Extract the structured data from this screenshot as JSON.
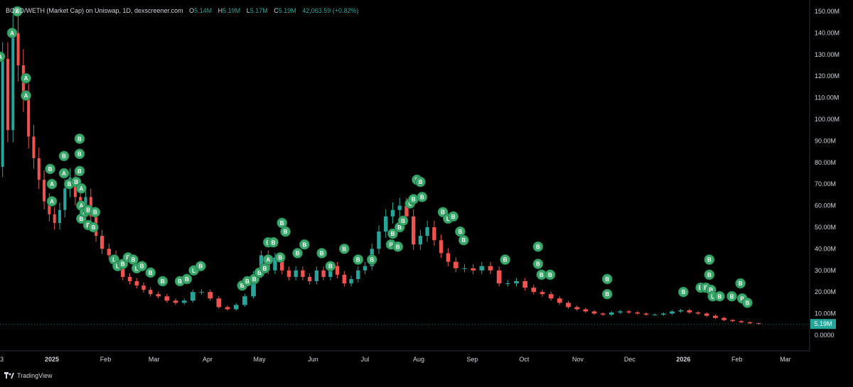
{
  "header": {
    "symbol": "BOBO/WETH (Market Cap) on Uniswap, 1D, dexscreener.com",
    "o_label": "O",
    "o_value": "5.14M",
    "h_label": "H",
    "h_value": "5.19M",
    "l_label": "L",
    "l_value": "5.17M",
    "c_label": "C",
    "c_value": "5.19M",
    "change": "42,063.59 (+0.82%)"
  },
  "footer": {
    "brand": "TradingView"
  },
  "colors": {
    "background": "#000000",
    "up": "#26a69a",
    "down": "#ef5350",
    "marker": "#3aa86b",
    "price_tag": "#26a69a",
    "axis_text": "#d1d4dc"
  },
  "chart_data": {
    "type": "candlestick",
    "title": "",
    "y_axis": {
      "ylim": [
        0,
        150000000
      ],
      "ticks": [
        {
          "value": 0,
          "label": "0.0000"
        },
        {
          "value": 10000000,
          "label": "10.00M"
        },
        {
          "value": 20000000,
          "label": "20.00M"
        },
        {
          "value": 30000000,
          "label": "30.00M"
        },
        {
          "value": 40000000,
          "label": "40.00M"
        },
        {
          "value": 50000000,
          "label": "50.00M"
        },
        {
          "value": 60000000,
          "label": "60.00M"
        },
        {
          "value": 70000000,
          "label": "70.00M"
        },
        {
          "value": 80000000,
          "label": "80.00M"
        },
        {
          "value": 90000000,
          "label": "90.00M"
        },
        {
          "value": 100000000,
          "label": "100.00M"
        },
        {
          "value": 110000000,
          "label": "110.00M"
        },
        {
          "value": 120000000,
          "label": "120.00M"
        },
        {
          "value": 130000000,
          "label": "130.00M"
        },
        {
          "value": 140000000,
          "label": "140.00M"
        },
        {
          "value": 150000000,
          "label": "150.00M"
        }
      ]
    },
    "x_axis": {
      "xlim": [
        "2024-12-02",
        "2026-03-15"
      ],
      "ticks": [
        {
          "date": "2024-12-03",
          "label": "3",
          "bold": false
        },
        {
          "date": "2025-01-01",
          "label": "2025",
          "bold": true
        },
        {
          "date": "2025-02-01",
          "label": "Feb",
          "bold": false
        },
        {
          "date": "2025-03-01",
          "label": "Mar",
          "bold": false
        },
        {
          "date": "2025-04-01",
          "label": "Apr",
          "bold": false
        },
        {
          "date": "2025-05-01",
          "label": "May",
          "bold": false
        },
        {
          "date": "2025-06-01",
          "label": "Jun",
          "bold": false
        },
        {
          "date": "2025-07-01",
          "label": "Jul",
          "bold": false
        },
        {
          "date": "2025-08-01",
          "label": "Aug",
          "bold": false
        },
        {
          "date": "2025-09-01",
          "label": "Sep",
          "bold": false
        },
        {
          "date": "2025-10-01",
          "label": "Oct",
          "bold": false
        },
        {
          "date": "2025-11-01",
          "label": "Nov",
          "bold": false
        },
        {
          "date": "2025-12-01",
          "label": "Dec",
          "bold": false
        },
        {
          "date": "2026-01-01",
          "label": "2026",
          "bold": true
        },
        {
          "date": "2026-02-01",
          "label": "Feb",
          "bold": false
        },
        {
          "date": "2026-03-01",
          "label": "Mar",
          "bold": false
        }
      ]
    },
    "last_price": {
      "value": 5190000,
      "label": "5.19M"
    },
    "series": [
      {
        "date": "2024-12-02",
        "close": 78000000
      },
      {
        "date": "2024-12-05",
        "close": 128000000
      },
      {
        "date": "2024-12-08",
        "close": 95000000
      },
      {
        "date": "2024-12-11",
        "close": 140000000
      },
      {
        "date": "2024-12-14",
        "close": 125000000
      },
      {
        "date": "2024-12-17",
        "close": 110000000
      },
      {
        "date": "2024-12-20",
        "close": 92000000
      },
      {
        "date": "2024-12-23",
        "close": 82000000
      },
      {
        "date": "2024-12-26",
        "close": 72000000
      },
      {
        "date": "2024-12-29",
        "close": 62000000
      },
      {
        "date": "2025-01-01",
        "close": 56000000
      },
      {
        "date": "2025-01-04",
        "close": 52000000
      },
      {
        "date": "2025-01-07",
        "close": 58000000
      },
      {
        "date": "2025-01-10",
        "close": 68000000
      },
      {
        "date": "2025-01-13",
        "close": 73000000
      },
      {
        "date": "2025-01-16",
        "close": 64000000
      },
      {
        "date": "2025-01-19",
        "close": 60000000
      },
      {
        "date": "2025-01-22",
        "close": 64000000
      },
      {
        "date": "2025-01-25",
        "close": 55000000
      },
      {
        "date": "2025-01-28",
        "close": 46000000
      },
      {
        "date": "2025-02-01",
        "close": 40000000
      },
      {
        "date": "2025-02-05",
        "close": 37000000
      },
      {
        "date": "2025-02-09",
        "close": 32000000
      },
      {
        "date": "2025-02-13",
        "close": 27000000
      },
      {
        "date": "2025-02-17",
        "close": 25000000
      },
      {
        "date": "2025-02-21",
        "close": 23000000
      },
      {
        "date": "2025-02-25",
        "close": 21000000
      },
      {
        "date": "2025-03-01",
        "close": 19000000
      },
      {
        "date": "2025-03-06",
        "close": 18000000
      },
      {
        "date": "2025-03-11",
        "close": 16000000
      },
      {
        "date": "2025-03-16",
        "close": 15000000
      },
      {
        "date": "2025-03-21",
        "close": 16000000
      },
      {
        "date": "2025-03-26",
        "close": 20000000
      },
      {
        "date": "2025-03-31",
        "close": 20000000
      },
      {
        "date": "2025-04-05",
        "close": 17000000
      },
      {
        "date": "2025-04-10",
        "close": 13000000
      },
      {
        "date": "2025-04-15",
        "close": 12000000
      },
      {
        "date": "2025-04-20",
        "close": 14000000
      },
      {
        "date": "2025-04-25",
        "close": 18000000
      },
      {
        "date": "2025-04-30",
        "close": 28000000
      },
      {
        "date": "2025-05-04",
        "close": 37000000
      },
      {
        "date": "2025-05-08",
        "close": 30000000
      },
      {
        "date": "2025-05-12",
        "close": 36000000
      },
      {
        "date": "2025-05-16",
        "close": 30000000
      },
      {
        "date": "2025-05-20",
        "close": 27000000
      },
      {
        "date": "2025-05-24",
        "close": 30000000
      },
      {
        "date": "2025-05-28",
        "close": 27000000
      },
      {
        "date": "2025-06-01",
        "close": 25000000
      },
      {
        "date": "2025-06-05",
        "close": 30000000
      },
      {
        "date": "2025-06-09",
        "close": 27000000
      },
      {
        "date": "2025-06-13",
        "close": 32000000
      },
      {
        "date": "2025-06-17",
        "close": 28000000
      },
      {
        "date": "2025-06-21",
        "close": 24000000
      },
      {
        "date": "2025-06-25",
        "close": 26000000
      },
      {
        "date": "2025-06-29",
        "close": 30000000
      },
      {
        "date": "2025-07-03",
        "close": 32000000
      },
      {
        "date": "2025-07-07",
        "close": 40000000
      },
      {
        "date": "2025-07-11",
        "close": 48000000
      },
      {
        "date": "2025-07-15",
        "close": 55000000
      },
      {
        "date": "2025-07-19",
        "close": 58000000
      },
      {
        "date": "2025-07-23",
        "close": 60000000
      },
      {
        "date": "2025-07-27",
        "close": 55000000
      },
      {
        "date": "2025-07-31",
        "close": 42000000
      },
      {
        "date": "2025-08-04",
        "close": 46000000
      },
      {
        "date": "2025-08-08",
        "close": 50000000
      },
      {
        "date": "2025-08-12",
        "close": 44000000
      },
      {
        "date": "2025-08-16",
        "close": 38000000
      },
      {
        "date": "2025-08-20",
        "close": 34000000
      },
      {
        "date": "2025-08-25",
        "close": 31000000
      },
      {
        "date": "2025-08-30",
        "close": 31000000
      },
      {
        "date": "2025-09-04",
        "close": 30000000
      },
      {
        "date": "2025-09-09",
        "close": 32000000
      },
      {
        "date": "2025-09-14",
        "close": 30000000
      },
      {
        "date": "2025-09-19",
        "close": 24000000
      },
      {
        "date": "2025-09-24",
        "close": 24000000
      },
      {
        "date": "2025-09-29",
        "close": 25000000
      },
      {
        "date": "2025-10-04",
        "close": 22000000
      },
      {
        "date": "2025-10-09",
        "close": 20000000
      },
      {
        "date": "2025-10-14",
        "close": 19000000
      },
      {
        "date": "2025-10-19",
        "close": 17000000
      },
      {
        "date": "2025-10-24",
        "close": 15000000
      },
      {
        "date": "2025-10-29",
        "close": 13000000
      },
      {
        "date": "2025-11-03",
        "close": 12000000
      },
      {
        "date": "2025-11-08",
        "close": 11000000
      },
      {
        "date": "2025-11-13",
        "close": 10000000
      },
      {
        "date": "2025-11-18",
        "close": 9500000
      },
      {
        "date": "2025-11-23",
        "close": 10500000
      },
      {
        "date": "2025-11-28",
        "close": 11000000
      },
      {
        "date": "2025-12-03",
        "close": 10500000
      },
      {
        "date": "2025-12-08",
        "close": 10000000
      },
      {
        "date": "2025-12-13",
        "close": 9500000
      },
      {
        "date": "2025-12-18",
        "close": 9500000
      },
      {
        "date": "2025-12-23",
        "close": 10000000
      },
      {
        "date": "2025-12-28",
        "close": 11000000
      },
      {
        "date": "2026-01-02",
        "close": 11500000
      },
      {
        "date": "2026-01-07",
        "close": 10500000
      },
      {
        "date": "2026-01-12",
        "close": 10000000
      },
      {
        "date": "2026-01-17",
        "close": 9000000
      },
      {
        "date": "2026-01-22",
        "close": 8000000
      },
      {
        "date": "2026-01-27",
        "close": 7000000
      },
      {
        "date": "2026-02-01",
        "close": 6500000
      },
      {
        "date": "2026-02-06",
        "close": 6000000
      },
      {
        "date": "2026-02-11",
        "close": 5500000
      },
      {
        "date": "2026-02-16",
        "close": 5190000
      }
    ],
    "markers": [
      {
        "date": "2024-12-02",
        "value": 129000000,
        "label": "A"
      },
      {
        "date": "2024-12-09",
        "value": 140000000,
        "label": "A"
      },
      {
        "date": "2024-12-12",
        "value": 150000000,
        "label": "A"
      },
      {
        "date": "2024-12-17",
        "value": 119000000,
        "label": "A"
      },
      {
        "date": "2024-12-17",
        "value": 111000000,
        "label": "A"
      },
      {
        "date": "2024-12-31",
        "value": 77000000,
        "label": "B"
      },
      {
        "date": "2025-01-01",
        "value": 70000000,
        "label": "A"
      },
      {
        "date": "2025-01-01",
        "value": 62000000,
        "label": "A"
      },
      {
        "date": "2025-01-08",
        "value": 83000000,
        "label": "B"
      },
      {
        "date": "2025-01-08",
        "value": 75000000,
        "label": "A"
      },
      {
        "date": "2025-01-11",
        "value": 70000000,
        "label": "B"
      },
      {
        "date": "2025-01-15",
        "value": 71000000,
        "label": "B"
      },
      {
        "date": "2025-01-17",
        "value": 91000000,
        "label": "B"
      },
      {
        "date": "2025-01-17",
        "value": 84000000,
        "label": "B"
      },
      {
        "date": "2025-01-17",
        "value": 76000000,
        "label": "B"
      },
      {
        "date": "2025-01-18",
        "value": 68000000,
        "label": "A"
      },
      {
        "date": "2025-01-18",
        "value": 60000000,
        "label": "A"
      },
      {
        "date": "2025-01-18",
        "value": 54000000,
        "label": "B"
      },
      {
        "date": "2025-01-20",
        "value": 57000000,
        "label": "A"
      },
      {
        "date": "2025-01-22",
        "value": 58000000,
        "label": "B"
      },
      {
        "date": "2025-01-22",
        "value": 51000000,
        "label": "B"
      },
      {
        "date": "2025-01-25",
        "value": 50000000,
        "label": "B"
      },
      {
        "date": "2025-01-26",
        "value": 57000000,
        "label": "B"
      },
      {
        "date": "2025-02-06",
        "value": 35000000,
        "label": "L"
      },
      {
        "date": "2025-02-08",
        "value": 32000000,
        "label": "L"
      },
      {
        "date": "2025-02-11",
        "value": 33000000,
        "label": "B"
      },
      {
        "date": "2025-02-14",
        "value": 36000000,
        "label": "P"
      },
      {
        "date": "2025-02-17",
        "value": 35000000,
        "label": "B"
      },
      {
        "date": "2025-02-19",
        "value": 31000000,
        "label": "L"
      },
      {
        "date": "2025-02-22",
        "value": 32000000,
        "label": "B"
      },
      {
        "date": "2025-02-27",
        "value": 29000000,
        "label": "B"
      },
      {
        "date": "2025-03-06",
        "value": 25000000,
        "label": "B"
      },
      {
        "date": "2025-03-16",
        "value": 25000000,
        "label": "B"
      },
      {
        "date": "2025-03-20",
        "value": 26000000,
        "label": "B"
      },
      {
        "date": "2025-03-24",
        "value": 30000000,
        "label": "L"
      },
      {
        "date": "2025-03-28",
        "value": 32000000,
        "label": "B"
      },
      {
        "date": "2025-04-21",
        "value": 23000000,
        "label": "B"
      },
      {
        "date": "2025-04-24",
        "value": 25000000,
        "label": "B"
      },
      {
        "date": "2025-04-28",
        "value": 26000000,
        "label": "B"
      },
      {
        "date": "2025-05-01",
        "value": 29000000,
        "label": "B"
      },
      {
        "date": "2025-05-04",
        "value": 31000000,
        "label": "B"
      },
      {
        "date": "2025-05-06",
        "value": 35000000,
        "label": "A"
      },
      {
        "date": "2025-05-06",
        "value": 43000000,
        "label": "B"
      },
      {
        "date": "2025-05-09",
        "value": 43000000,
        "label": "B"
      },
      {
        "date": "2025-05-13",
        "value": 36000000,
        "label": "B"
      },
      {
        "date": "2025-05-14",
        "value": 52000000,
        "label": "B"
      },
      {
        "date": "2025-05-16",
        "value": 48000000,
        "label": "B"
      },
      {
        "date": "2025-05-23",
        "value": 38000000,
        "label": "B"
      },
      {
        "date": "2025-05-27",
        "value": 42000000,
        "label": "B"
      },
      {
        "date": "2025-06-06",
        "value": 38000000,
        "label": "B"
      },
      {
        "date": "2025-06-11",
        "value": 32000000,
        "label": "B"
      },
      {
        "date": "2025-06-19",
        "value": 40000000,
        "label": "B"
      },
      {
        "date": "2025-06-27",
        "value": 35000000,
        "label": "B"
      },
      {
        "date": "2025-07-05",
        "value": 35000000,
        "label": "B"
      },
      {
        "date": "2025-07-16",
        "value": 42000000,
        "label": "P"
      },
      {
        "date": "2025-07-17",
        "value": 47000000,
        "label": "B"
      },
      {
        "date": "2025-07-20",
        "value": 41000000,
        "label": "B"
      },
      {
        "date": "2025-07-21",
        "value": 50000000,
        "label": "B"
      },
      {
        "date": "2025-07-23",
        "value": 53000000,
        "label": "B"
      },
      {
        "date": "2025-07-27",
        "value": 61000000,
        "label": "L"
      },
      {
        "date": "2025-07-29",
        "value": 63000000,
        "label": "B"
      },
      {
        "date": "2025-07-31",
        "value": 72000000,
        "label": "P"
      },
      {
        "date": "2025-08-02",
        "value": 71000000,
        "label": "B"
      },
      {
        "date": "2025-08-03",
        "value": 64000000,
        "label": "B"
      },
      {
        "date": "2025-08-15",
        "value": 57000000,
        "label": "B"
      },
      {
        "date": "2025-08-18",
        "value": 54000000,
        "label": "L"
      },
      {
        "date": "2025-08-21",
        "value": 55000000,
        "label": "B"
      },
      {
        "date": "2025-08-25",
        "value": 48000000,
        "label": "B"
      },
      {
        "date": "2025-08-27",
        "value": 44000000,
        "label": "B"
      },
      {
        "date": "2025-09-20",
        "value": 35000000,
        "label": "B"
      },
      {
        "date": "2025-10-09",
        "value": 41000000,
        "label": "B"
      },
      {
        "date": "2025-10-09",
        "value": 33000000,
        "label": "B"
      },
      {
        "date": "2025-10-11",
        "value": 28000000,
        "label": "B"
      },
      {
        "date": "2025-10-16",
        "value": 28000000,
        "label": "B"
      },
      {
        "date": "2025-11-18",
        "value": 26000000,
        "label": "B"
      },
      {
        "date": "2025-11-18",
        "value": 19000000,
        "label": "B"
      },
      {
        "date": "2026-01-01",
        "value": 20000000,
        "label": "B"
      },
      {
        "date": "2026-01-11",
        "value": 22000000,
        "label": "B"
      },
      {
        "date": "2026-01-14",
        "value": 22000000,
        "label": "B"
      },
      {
        "date": "2026-01-16",
        "value": 35000000,
        "label": "B"
      },
      {
        "date": "2026-01-16",
        "value": 28000000,
        "label": "B"
      },
      {
        "date": "2026-01-17",
        "value": 21000000,
        "label": "B"
      },
      {
        "date": "2026-01-18",
        "value": 18000000,
        "label": "L"
      },
      {
        "date": "2026-01-22",
        "value": 18000000,
        "label": "B"
      },
      {
        "date": "2026-01-29",
        "value": 18000000,
        "label": "B"
      },
      {
        "date": "2026-02-03",
        "value": 24000000,
        "label": "B"
      },
      {
        "date": "2026-02-04",
        "value": 17000000,
        "label": "P"
      },
      {
        "date": "2026-02-07",
        "value": 15000000,
        "label": "B"
      }
    ]
  }
}
